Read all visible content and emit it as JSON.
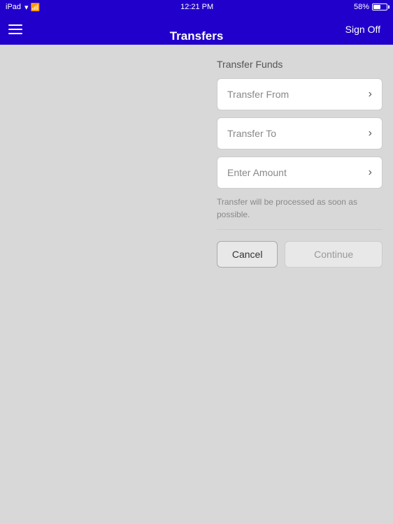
{
  "statusBar": {
    "device": "iPad",
    "time": "12:21 PM",
    "battery": "58%"
  },
  "navBar": {
    "title": "Transfers",
    "signOffLabel": "Sign Off",
    "menuIconLabel": "menu"
  },
  "transferFunds": {
    "sectionTitle": "Transfer Funds",
    "transferFromLabel": "Transfer From",
    "transferToLabel": "Transfer To",
    "enterAmountLabel": "Enter Amount",
    "infoText": "Transfer will be processed as soon as possible.",
    "cancelLabel": "Cancel",
    "continueLabel": "Continue"
  }
}
